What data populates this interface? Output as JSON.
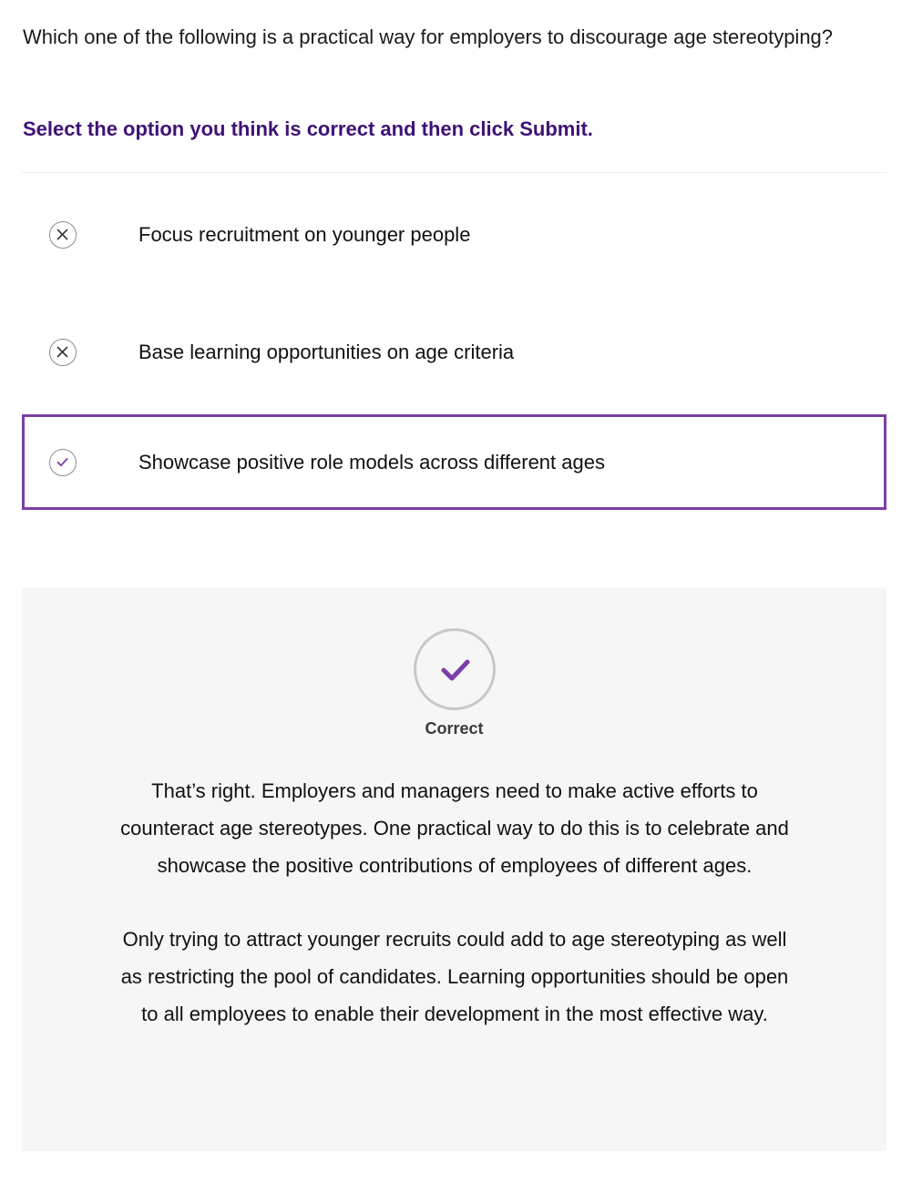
{
  "question": {
    "text": "Which one of the following is a practical way for employers to discourage age stereotyping?"
  },
  "instruction": "Select the option you think is correct and then click Submit.",
  "options": [
    {
      "label": "Focus recruitment on younger people",
      "status_icon": "cross-icon",
      "selected": false
    },
    {
      "label": "Base learning opportunities on age criteria",
      "status_icon": "cross-icon",
      "selected": false
    },
    {
      "label": "Showcase positive role models across different ages",
      "status_icon": "check-icon",
      "selected": true
    }
  ],
  "feedback": {
    "icon": "check-icon",
    "result_label": "Correct",
    "paragraphs": [
      "That’s right. Employers and managers need to make active efforts to counteract age stereotypes. One practical way to do this is to celebrate and showcase the positive contributions of employees of different ages.",
      "Only trying to attract younger recruits could add to age stereotyping as well as restricting the pool of candidates. Learning opportunities should be open to all employees to enable their development in the most effective way."
    ]
  },
  "colors": {
    "accent": "#7b3fa8",
    "instruction": "#3f1276",
    "feedback_background": "#f6f6f6",
    "icon_border": "#c8c8c8"
  }
}
